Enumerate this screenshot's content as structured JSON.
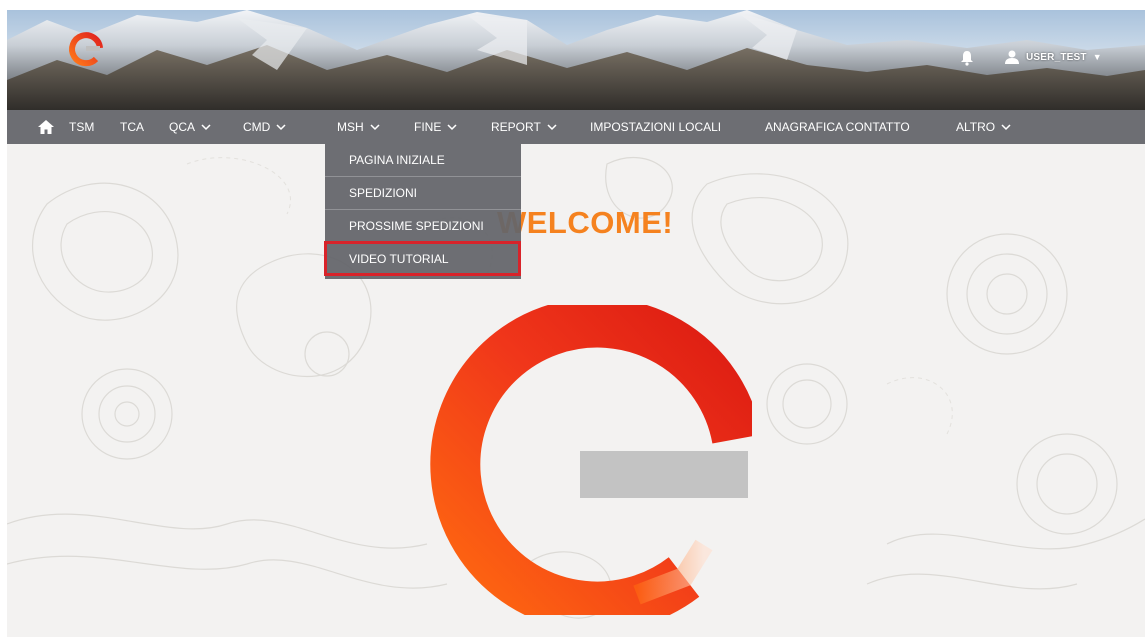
{
  "header": {
    "user_label": "USER_TEST",
    "user_caret": "▼",
    "logo_icon": "enel-e-logo",
    "notification_icon": "bell-icon"
  },
  "nav": {
    "home_icon": "home-icon",
    "items": [
      {
        "label": "TSM",
        "has_dropdown": false
      },
      {
        "label": "TCA",
        "has_dropdown": false
      },
      {
        "label": "QCA",
        "has_dropdown": true
      },
      {
        "label": "CMD",
        "has_dropdown": true
      },
      {
        "label": "MSH",
        "has_dropdown": true
      },
      {
        "label": "FINE",
        "has_dropdown": true
      },
      {
        "label": "REPORT",
        "has_dropdown": true
      },
      {
        "label": "IMPOSTAZIONI LOCALI",
        "has_dropdown": false
      },
      {
        "label": "ANAGRAFICA CONTATTO",
        "has_dropdown": false
      },
      {
        "label": "ALTRO",
        "has_dropdown": true
      }
    ]
  },
  "dropdown": {
    "parent": "MSH",
    "items": [
      {
        "label": "PAGINA INIZIALE",
        "highlighted": false
      },
      {
        "label": "SPEDIZIONI",
        "highlighted": false
      },
      {
        "label": "PROSSIME SPEDIZIONI",
        "highlighted": false
      },
      {
        "label": "VIDEO TUTORIAL",
        "highlighted": true
      }
    ]
  },
  "main": {
    "welcome_text": "WELCOME!"
  },
  "colors": {
    "accent_orange": "#f5821f",
    "logo_red": "#e01e1e",
    "highlight_red": "#d8232a",
    "nav_gray": "#626368"
  }
}
